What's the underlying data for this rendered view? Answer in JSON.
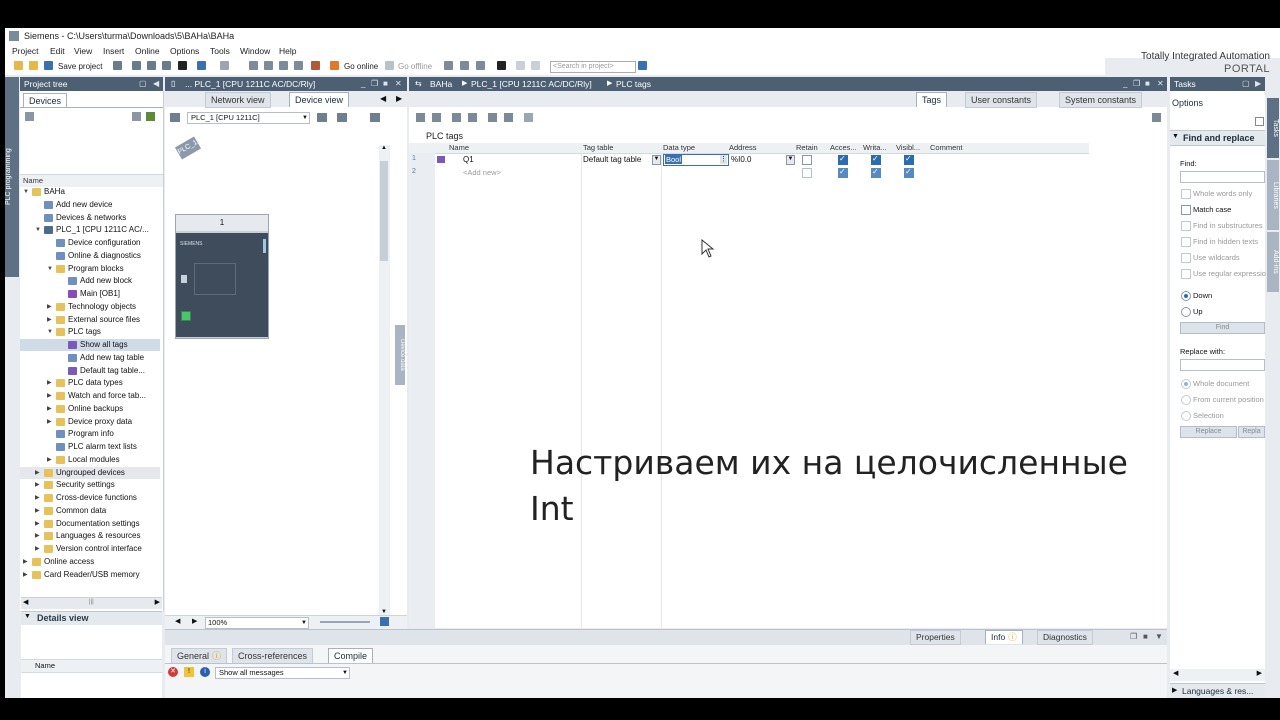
{
  "window": {
    "title": "Siemens  -  C:\\Users\\turma\\Downloads\\5\\BAHa\\BAHa"
  },
  "menu": [
    "Project",
    "Edit",
    "View",
    "Insert",
    "Online",
    "Options",
    "Tools",
    "Window",
    "Help"
  ],
  "brand": {
    "line1": "Totally Integrated Automation",
    "line2": "PORTAL"
  },
  "toolbar": {
    "save_label": "Save project",
    "go_online": "Go online",
    "go_offline": "Go offline",
    "search_placeholder": "<Search in project>"
  },
  "project_tree": {
    "header": "Project tree",
    "devices_tab": "Devices",
    "name_col": "Name",
    "items": [
      {
        "label": "BAHa"
      },
      {
        "label": "Add new device"
      },
      {
        "label": "Devices & networks"
      },
      {
        "label": "PLC_1 [CPU 1211C AC/..."
      },
      {
        "label": "Device configuration"
      },
      {
        "label": "Online & diagnostics"
      },
      {
        "label": "Program blocks"
      },
      {
        "label": "Add new block"
      },
      {
        "label": "Main [OB1]"
      },
      {
        "label": "Technology objects"
      },
      {
        "label": "External source files"
      },
      {
        "label": "PLC tags"
      },
      {
        "label": "Show all tags"
      },
      {
        "label": "Add new tag table"
      },
      {
        "label": "Default tag table..."
      },
      {
        "label": "PLC data types"
      },
      {
        "label": "Watch and force tab..."
      },
      {
        "label": "Online backups"
      },
      {
        "label": "Device proxy data"
      },
      {
        "label": "Program info"
      },
      {
        "label": "PLC alarm text lists"
      },
      {
        "label": "Local modules"
      },
      {
        "label": "Ungrouped devices"
      },
      {
        "label": "Security settings"
      },
      {
        "label": "Cross-device functions"
      },
      {
        "label": "Common data"
      },
      {
        "label": "Documentation settings"
      },
      {
        "label": "Languages & resources"
      },
      {
        "label": "Version control interface"
      },
      {
        "label": "Online access"
      },
      {
        "label": "Card Reader/USB memory"
      }
    ],
    "details_view": "Details view",
    "details_name_col": "Name",
    "side_label": "PLC programming"
  },
  "device_panel": {
    "header": "...  PLC_1 [CPU 1211C AC/DC/Rly]",
    "tab_network": "Network view",
    "tab_device": "Device view",
    "device_select": "PLC_1 [CPU 1211C]",
    "plc_tag": "PLC_1",
    "rack_slot": "1",
    "zoom": "100%",
    "side_label": "Device data"
  },
  "tags_editor": {
    "breadcrumb": [
      "BAHa",
      "PLC_1 [CPU 1211C AC/DC/Rly]",
      "PLC tags"
    ],
    "tab_tags": "Tags",
    "tab_user_constants": "User constants",
    "tab_system_constants": "System constants",
    "title": "PLC tags",
    "columns": [
      "Name",
      "Tag table",
      "Data type",
      "Address",
      "Retain",
      "Acces...",
      "Writa...",
      "Visibl...",
      "Comment"
    ],
    "rows": [
      {
        "num": "1",
        "name": "Q1",
        "table": "Default tag table",
        "type": "Bool",
        "address": "%I0.0"
      },
      {
        "num": "2",
        "name": "<Add new>",
        "table": "",
        "type": "",
        "address": ""
      }
    ]
  },
  "inspector": {
    "properties": "Properties",
    "info": "Info",
    "diagnostics": "Diagnostics",
    "tab_general": "General",
    "tab_cross_references": "Cross-references",
    "tab_compile": "Compile",
    "filter": "Show all messages"
  },
  "tasks": {
    "header": "Tasks",
    "options": "Options",
    "find_replace": "Find and replace",
    "find_label": "Find:",
    "whole_words": "Whole words only",
    "match_case": "Match case",
    "find_substructures": "Find in substructures",
    "find_hidden": "Find in hidden texts",
    "wildcards": "Use wildcards",
    "regex": "Use regular expressio",
    "down": "Down",
    "up": "Up",
    "find_button": "Find",
    "replace_with": "Replace with:",
    "whole_document": "Whole document",
    "from_current": "From current position",
    "selection": "Selection",
    "replace_button": "Replace",
    "replace_all_button": "Repla",
    "languages": "Languages & res...",
    "side_tabs": [
      "Tasks",
      "Libraries",
      "Add-ins"
    ]
  },
  "subtitle": {
    "line1": "Настриваем их на целочисленные",
    "line2": "Int"
  },
  "colors": {
    "accent": "#2b6cb0",
    "header_bg": "#4d5f72",
    "selection": "#cfdbe7"
  }
}
